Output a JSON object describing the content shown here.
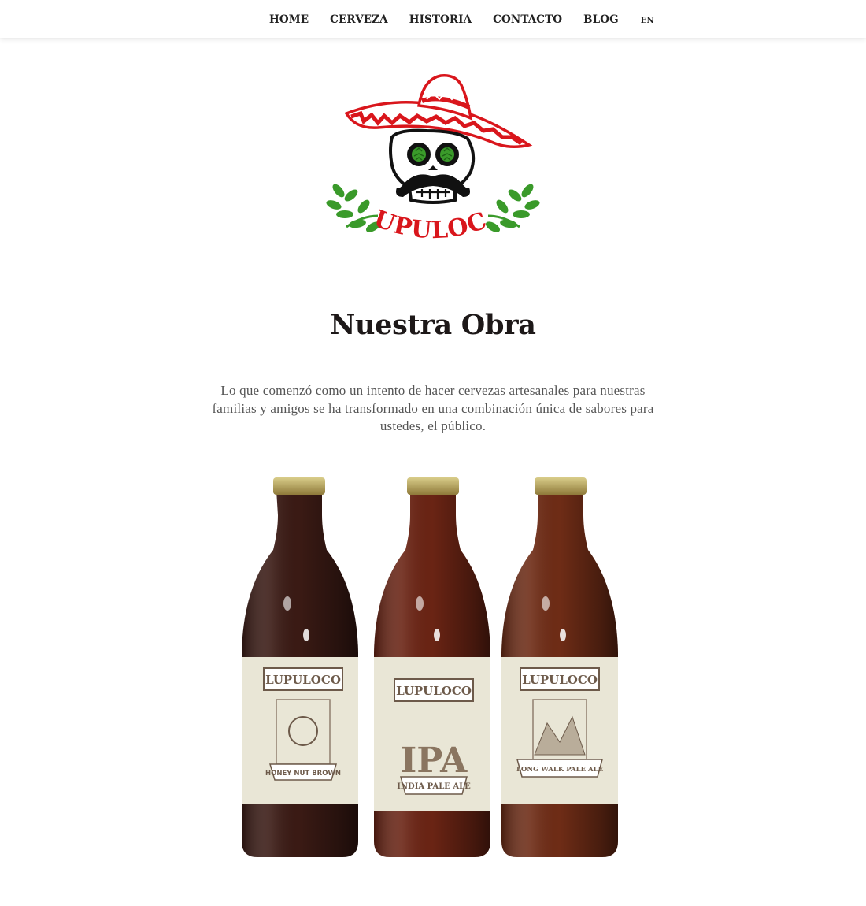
{
  "nav": {
    "items": [
      "HOME",
      "CERVEZA",
      "HISTORIA",
      "CONTACTO",
      "BLOG"
    ],
    "lang": "EN"
  },
  "logo": {
    "text": "LUPULOCO"
  },
  "main": {
    "title": "Nuestra Obra",
    "intro": "Lo que comenzó como un intento de hacer cervezas artesanales para nuestras familias y amigos se ha transformado en una combinación única de sabores para ustedes, el público."
  },
  "bottles": [
    {
      "brand": "LUPULOCO",
      "style": "HONEY NUT BROWN",
      "big": "",
      "glass": "#3a1a14"
    },
    {
      "brand": "LUPULOCO",
      "style": "INDIA PALE ALE",
      "big": "IPA",
      "glass": "#6a2414"
    },
    {
      "brand": "LUPULOCO",
      "style": "LONG WALK PALE ALE",
      "big": "",
      "glass": "#6e2c16"
    }
  ],
  "colors": {
    "sombrero": "#d9161c",
    "hop_green": "#3a9a2a",
    "label_brown": "#6d5a4a",
    "label_bg": "#e9e6d6"
  }
}
